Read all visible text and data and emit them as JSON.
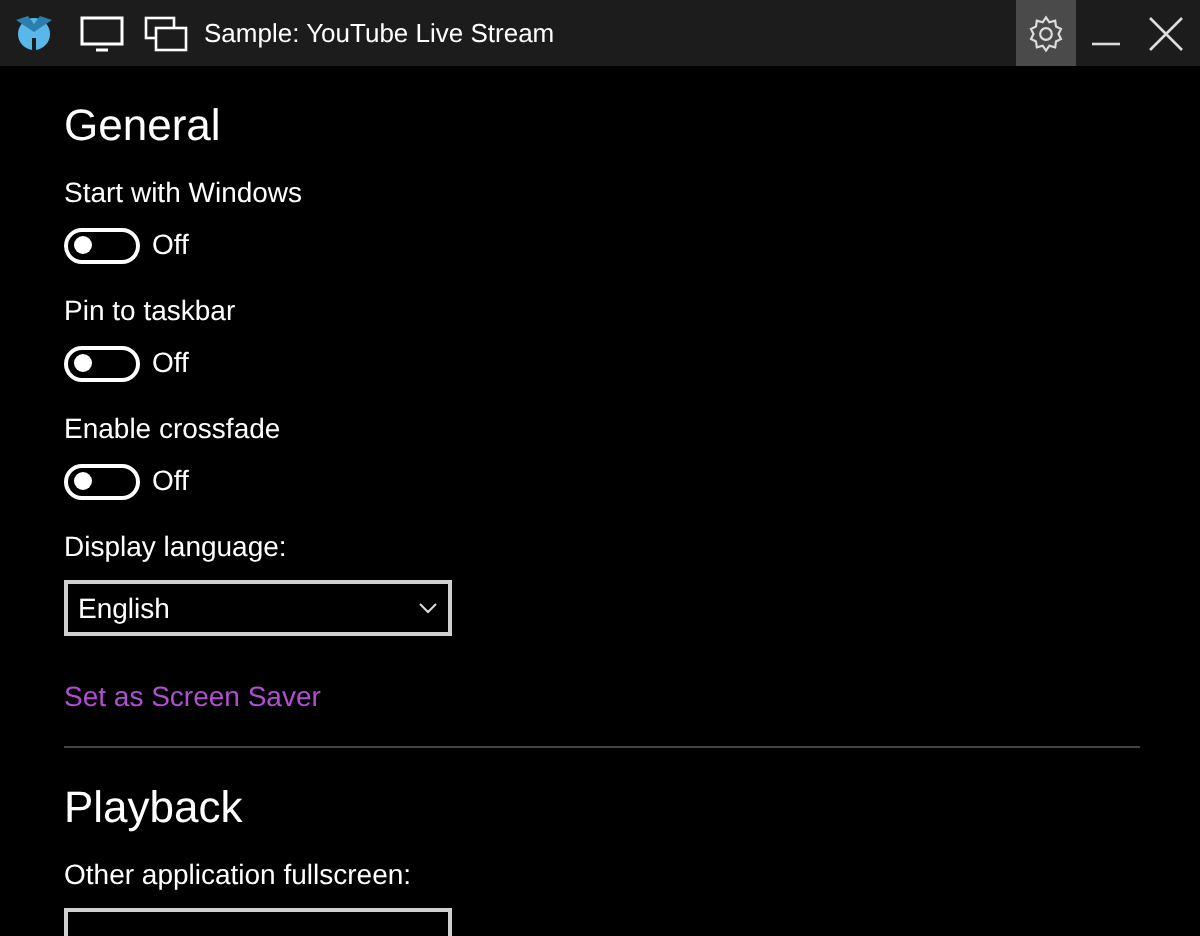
{
  "window": {
    "title": "Sample: YouTube Live Stream",
    "settings_selected": true
  },
  "sections": [
    {
      "title": "General",
      "items": [
        {
          "kind": "toggle",
          "label": "Start with Windows",
          "on": false,
          "state_text": "Off"
        },
        {
          "kind": "toggle",
          "label": "Pin to taskbar",
          "on": false,
          "state_text": "Off"
        },
        {
          "kind": "toggle",
          "label": "Enable crossfade",
          "on": false,
          "state_text": "Off"
        },
        {
          "kind": "dropdown",
          "label": "Display language:",
          "value": "English"
        },
        {
          "kind": "link",
          "label": "Set as Screen Saver"
        }
      ]
    },
    {
      "title": "Playback",
      "items": [
        {
          "kind": "dropdown",
          "label": "Other application fullscreen:"
        }
      ]
    }
  ]
}
